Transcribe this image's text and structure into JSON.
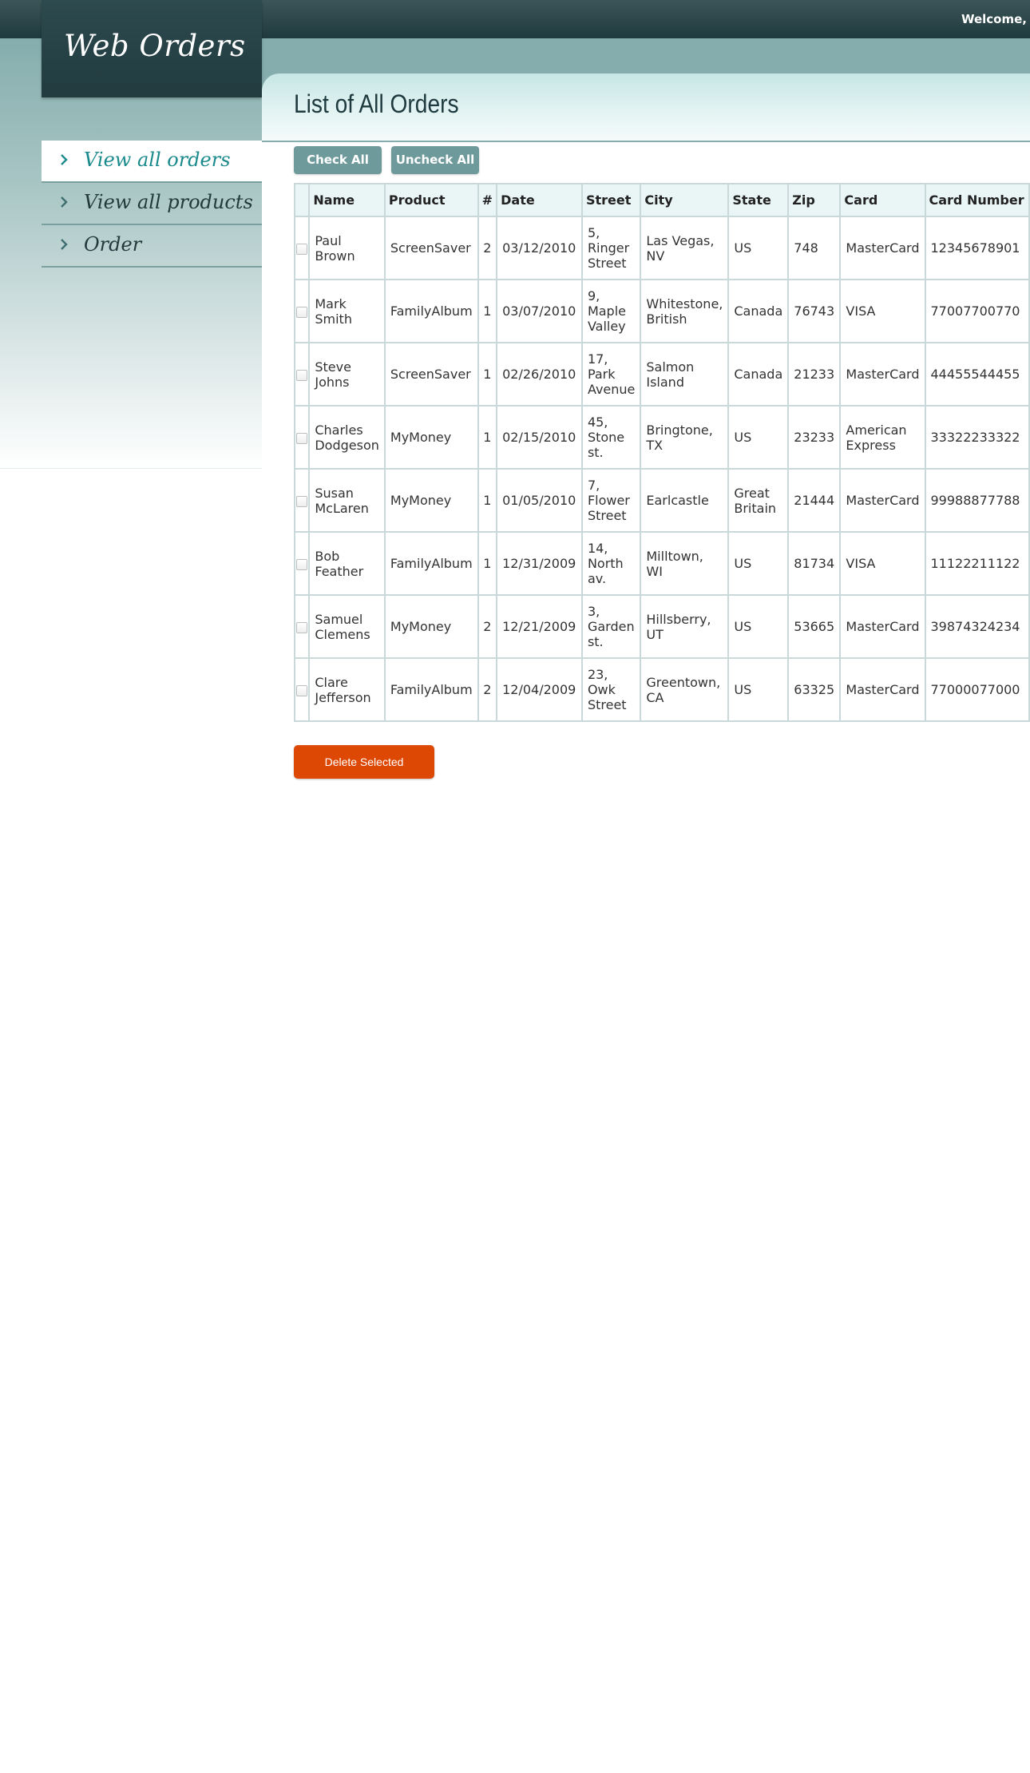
{
  "header": {
    "welcome_text": "Welcome,"
  },
  "app": {
    "logo_text": "Web Orders"
  },
  "sidebar": {
    "items": [
      {
        "label": "View all orders",
        "active": true
      },
      {
        "label": "View all products",
        "active": false
      },
      {
        "label": "Order",
        "active": false
      }
    ]
  },
  "main": {
    "title": "List of All Orders",
    "check_all_label": "Check All",
    "uncheck_all_label": "Uncheck All",
    "delete_label": "Delete Selected"
  },
  "table": {
    "columns": [
      "",
      "Name",
      "Product",
      "#",
      "Date",
      "Street",
      "City",
      "State",
      "Zip",
      "Card",
      "Card Number"
    ],
    "rows": [
      {
        "name": "Paul Brown",
        "product": "ScreenSaver",
        "qty": "2",
        "date": "03/12/2010",
        "street": "5, Ringer Street",
        "city": "Las Vegas, NV",
        "state": "US",
        "zip": "748",
        "card": "MasterCard",
        "card_number": "12345678901"
      },
      {
        "name": "Mark Smith",
        "product": "FamilyAlbum",
        "qty": "1",
        "date": "03/07/2010",
        "street": "9, Maple Valley",
        "city": "Whitestone, British",
        "state": "Canada",
        "zip": "76743",
        "card": "VISA",
        "card_number": "77007700770"
      },
      {
        "name": "Steve Johns",
        "product": "ScreenSaver",
        "qty": "1",
        "date": "02/26/2010",
        "street": "17, Park Avenue",
        "city": "Salmon Island",
        "state": "Canada",
        "zip": "21233",
        "card": "MasterCard",
        "card_number": "44455544455"
      },
      {
        "name": "Charles Dodgeson",
        "product": "MyMoney",
        "qty": "1",
        "date": "02/15/2010",
        "street": "45, Stone st.",
        "city": "Bringtone, TX",
        "state": "US",
        "zip": "23233",
        "card": "American Express",
        "card_number": "33322233322"
      },
      {
        "name": "Susan McLaren",
        "product": "MyMoney",
        "qty": "1",
        "date": "01/05/2010",
        "street": "7, Flower Street",
        "city": "Earlcastle",
        "state": "Great Britain",
        "zip": "21444",
        "card": "MasterCard",
        "card_number": "99988877788"
      },
      {
        "name": "Bob Feather",
        "product": "FamilyAlbum",
        "qty": "1",
        "date": "12/31/2009",
        "street": "14, North av.",
        "city": "Milltown, WI",
        "state": "US",
        "zip": "81734",
        "card": "VISA",
        "card_number": "11122211122"
      },
      {
        "name": "Samuel Clemens",
        "product": "MyMoney",
        "qty": "2",
        "date": "12/21/2009",
        "street": "3, Garden st.",
        "city": "Hillsberry, UT",
        "state": "US",
        "zip": "53665",
        "card": "MasterCard",
        "card_number": "39874324234"
      },
      {
        "name": "Clare Jefferson",
        "product": "FamilyAlbum",
        "qty": "2",
        "date": "12/04/2009",
        "street": "23, Owk Street",
        "city": "Greentown, CA",
        "state": "US",
        "zip": "63325",
        "card": "MasterCard",
        "card_number": "77000077000"
      }
    ]
  },
  "colors": {
    "topbar": "#1f3a3e",
    "accent_teal": "#1a8a8c",
    "button_teal": "#6f9a9b",
    "delete_orange": "#dd4904"
  },
  "icons": {
    "nav_bullet": "chevron-right-icon",
    "row_select": "checkbox"
  }
}
